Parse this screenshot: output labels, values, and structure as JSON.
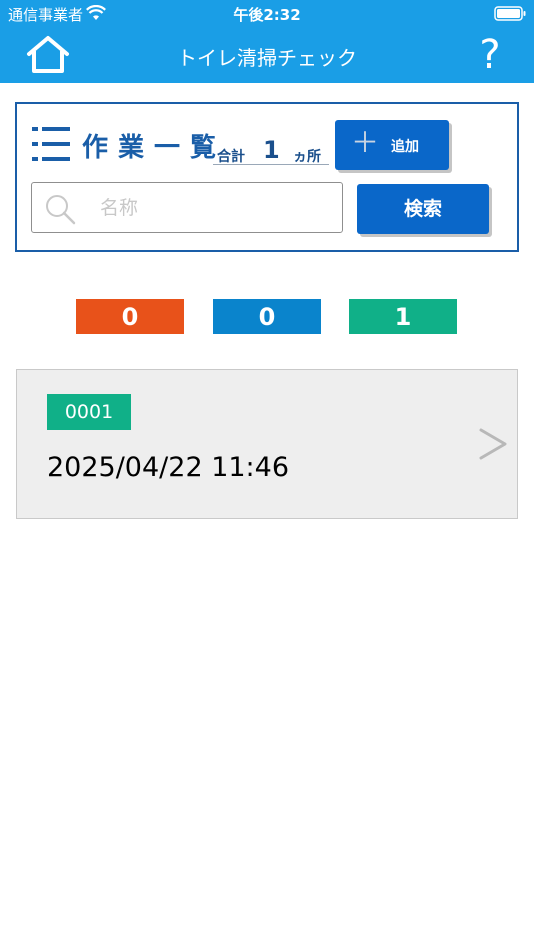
{
  "status_bar": {
    "carrier": "通信事業者",
    "time": "午後2:32"
  },
  "nav": {
    "title": "トイレ清掃チェック",
    "help_label": "?",
    "home_icon": "home-icon"
  },
  "work_list": {
    "title": "作業一覧",
    "total_label": "合計",
    "total_count": "1",
    "total_unit": "ヵ所",
    "add_button": {
      "icon": "＋",
      "label": "追加"
    },
    "search": {
      "placeholder": "名称",
      "value": "",
      "button_label": "検索"
    }
  },
  "counters": [
    {
      "value": "0",
      "color": "#e8521a"
    },
    {
      "value": "0",
      "color": "#0a84cc"
    },
    {
      "value": "1",
      "color": "#10b088"
    }
  ],
  "items": [
    {
      "code": "0001",
      "code_color": "#10b088",
      "datetime": "2025/04/22 11:46"
    }
  ],
  "colors": {
    "header": "#1a9ee6",
    "primary_button": "#0a67c9",
    "panel_border": "#1a5ea8"
  }
}
